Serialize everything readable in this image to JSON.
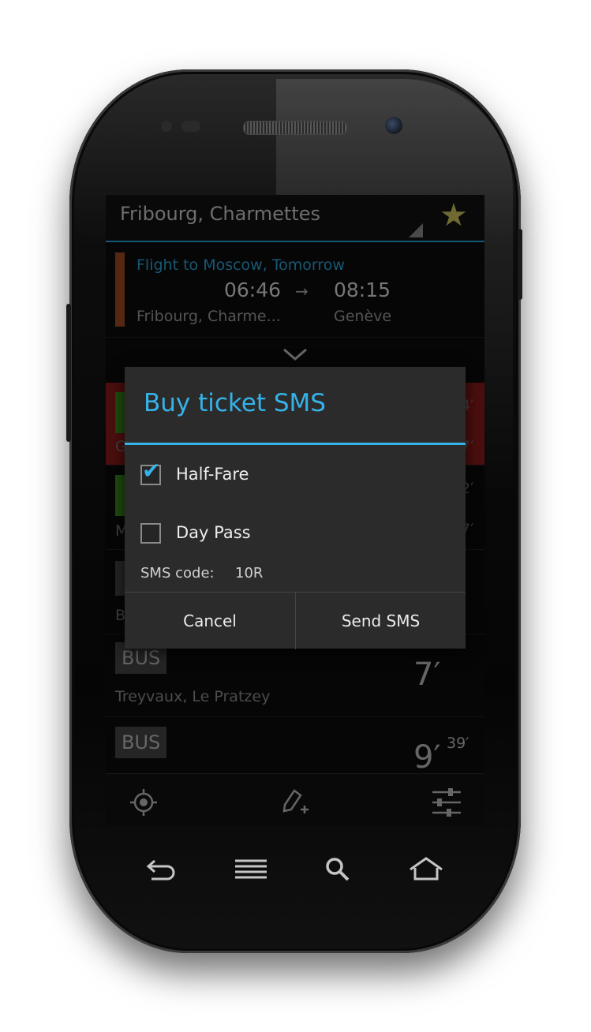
{
  "action_bar": {
    "title": "Fribourg, Charmettes",
    "favorite_icon": "star-icon"
  },
  "trip": {
    "title": "Flight to Moscow, Tomorrow",
    "departure_time": "06:46",
    "arrow": "→",
    "arrival_time": "08:15",
    "from": "Fribourg, Charme...",
    "to": "Genève"
  },
  "rows": [
    {
      "tag": "BUS",
      "destination": "Treyvaux, Le Pratzey",
      "minutes": "7′",
      "seconds": ""
    },
    {
      "tag": "BUS",
      "destination": "",
      "minutes": "9′",
      "seconds": "39′"
    }
  ],
  "ghost_text": {
    "row1_right_top": "4′",
    "row1_left": "G",
    "row1_right_bottom": "7′",
    "row2_right_top": "2′",
    "row2_left": "M",
    "row2_right_bottom": "7′",
    "row3_left": "B"
  },
  "bottom_bar": {
    "icons": [
      "locate-icon",
      "edit-add-icon",
      "settings-sliders-icon"
    ]
  },
  "nav_keys": {
    "icons": [
      "back-icon",
      "menu-icon",
      "search-icon",
      "home-icon"
    ]
  },
  "dialog": {
    "title": "Buy ticket SMS",
    "options": [
      {
        "label": "Half-Fare",
        "checked": true
      },
      {
        "label": "Day Pass",
        "checked": false
      }
    ],
    "sms_code_label": "SMS code:",
    "sms_code_value": "10R",
    "cancel_label": "Cancel",
    "send_label": "Send SMS"
  },
  "colors": {
    "accent": "#35b2e8",
    "favorite": "#c9c15a",
    "delay_row": "#8a1a1a"
  }
}
